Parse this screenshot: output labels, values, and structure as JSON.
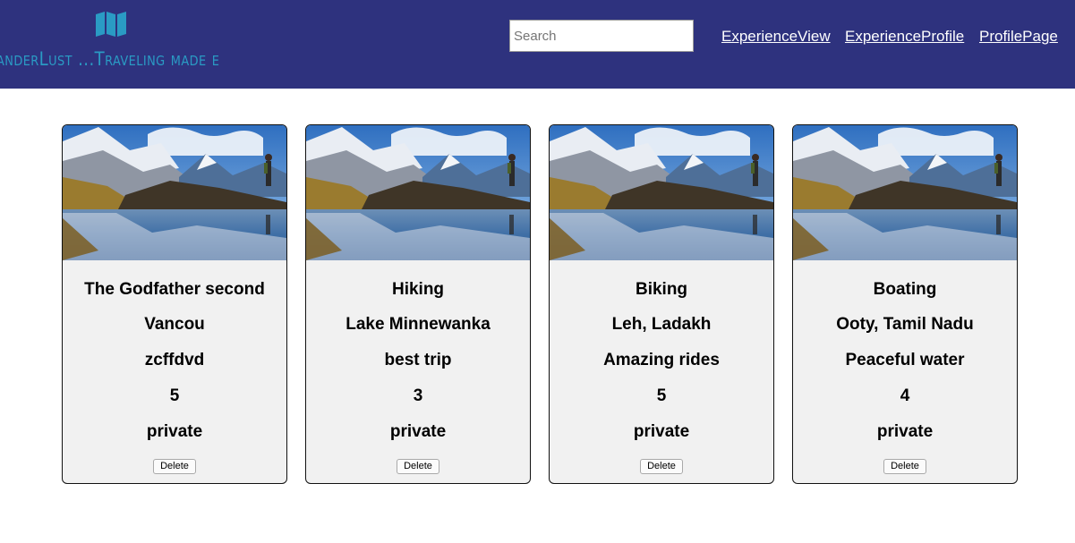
{
  "header": {
    "brand_icon": "map-icon",
    "brand_text": "anderLust ...Traveling made easy",
    "search_placeholder": "Search",
    "nav": [
      "ExperienceView",
      "ExperienceProfile",
      "ProfilePage"
    ]
  },
  "colors": {
    "header_bg": "#2e327e",
    "brand": "#2a9bc4",
    "card_bg": "#f1f1f1"
  },
  "cards": [
    {
      "image": "mountain-lake-hiker-photo",
      "title": "The Godfather second",
      "location": "Vancou",
      "description": "zcffdvd",
      "rating": "5",
      "visibility": "private",
      "delete_label": "Delete"
    },
    {
      "image": "mountain-lake-hiker-photo",
      "title": "Hiking",
      "location": "Lake Minnewanka",
      "description": "best trip",
      "rating": "3",
      "visibility": "private",
      "delete_label": "Delete"
    },
    {
      "image": "mountain-lake-hiker-photo",
      "title": "Biking",
      "location": "Leh, Ladakh",
      "description": "Amazing rides",
      "rating": "5",
      "visibility": "private",
      "delete_label": "Delete"
    },
    {
      "image": "mountain-lake-hiker-photo",
      "title": "Boating",
      "location": "Ooty, Tamil Nadu",
      "description": "Peaceful water",
      "rating": "4",
      "visibility": "private",
      "delete_label": "Delete"
    }
  ]
}
